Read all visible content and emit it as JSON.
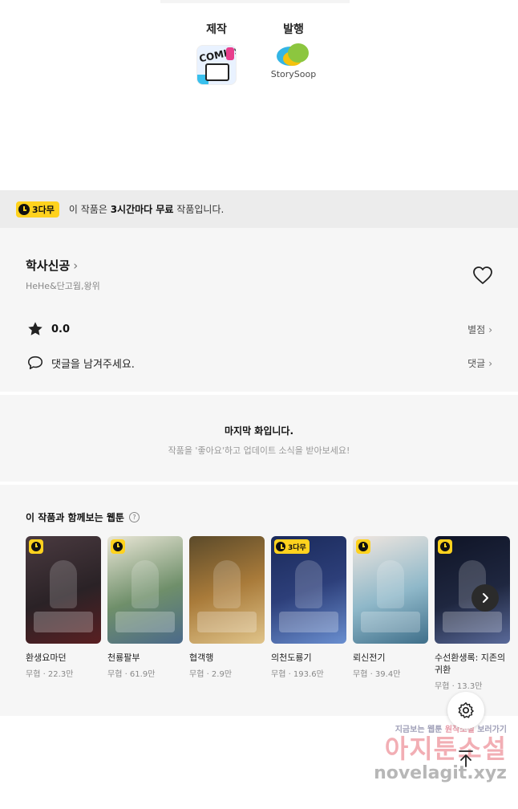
{
  "credits": [
    {
      "label": "제작",
      "logo_text": "COMICS",
      "icon": "comics-logo"
    },
    {
      "label": "발행",
      "logo_text": "StorySoop",
      "icon": "storysoop-logo"
    }
  ],
  "notice": {
    "badge": "3다무",
    "prefix": "이 작품은 ",
    "bold": "3시간마다 무료",
    "suffix": " 작품입니다."
  },
  "work": {
    "title": "학사신공",
    "chevron": "›",
    "authors": "HeHe&단고웜,왕위",
    "rating": "0.0",
    "rating_link": "별점",
    "comment_prompt": "댓글을 남겨주세요.",
    "comment_link": "댓글"
  },
  "last_episode": {
    "heading": "마지막 화입니다.",
    "sub": "작품을 '좋아요'하고 업데이트 소식을 받아보세요!"
  },
  "recommendations": {
    "title": "이 작품과 함께보는 웹툰",
    "help": "?",
    "items": [
      {
        "title": "환생요마던",
        "meta": "무협 · 22.3만",
        "badge": "clock",
        "color": "#2a2226"
      },
      {
        "title": "천룡팔부",
        "meta": "무협 · 61.9만",
        "badge": "clock",
        "color": "#6f8f6a"
      },
      {
        "title": "협객행",
        "meta": "무협 · 2.9만",
        "badge": "",
        "color": "#a97b3a"
      },
      {
        "title": "의천도룡기",
        "meta": "무협 · 193.6만",
        "badge": "3다무",
        "color": "#2d3f7a"
      },
      {
        "title": "뢰신전기",
        "meta": "무협 · 39.4만",
        "badge": "clock",
        "color": "#8fb8c9"
      },
      {
        "title": "수선환생록: 지존의 귀환",
        "meta": "무협 · 13.3만",
        "badge": "clock",
        "color": "#1f2740"
      }
    ]
  },
  "watermark": {
    "line1a": "지금보는 웹툰",
    "line1b": "원작소설",
    "line1c": "보러가기",
    "line2": "아지툰소설",
    "line3": "novelagit.xyz"
  },
  "colors": {
    "badge_yellow": "#ffd21e",
    "panel_bg": "#f6f6f6",
    "notice_bg": "#ececec"
  }
}
